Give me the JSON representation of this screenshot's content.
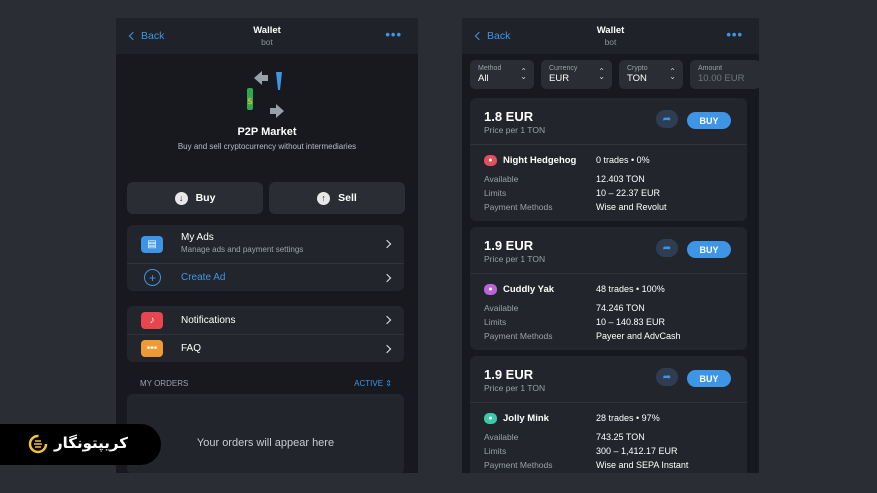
{
  "left": {
    "topbar": {
      "back": "Back",
      "title": "Wallet",
      "subtitle": "bot",
      "more": "•••"
    },
    "hero": {
      "title": "P2P Market",
      "subtitle": "Buy and sell cryptocurrency without intermediaries"
    },
    "actions": {
      "buy": "Buy",
      "sell": "Sell"
    },
    "menu1": [
      {
        "label": "My Ads",
        "sub": "Manage ads and payment settings"
      },
      {
        "label": "Create Ad"
      }
    ],
    "menu2": [
      {
        "label": "Notifications"
      },
      {
        "label": "FAQ"
      }
    ],
    "orders": {
      "heading": "MY ORDERS",
      "filter": "ACTIVE",
      "empty": "Your orders will appear here"
    }
  },
  "right": {
    "topbar": {
      "back": "Back",
      "title": "Wallet",
      "subtitle": "bot",
      "more": "•••"
    },
    "filters": [
      {
        "key": "Method",
        "value": "All"
      },
      {
        "key": "Currency",
        "value": "EUR"
      },
      {
        "key": "Crypto",
        "value": "TON"
      },
      {
        "key": "Amount",
        "value": "10.00 EUR"
      }
    ],
    "buy_label": "BUY",
    "labels": {
      "available": "Available",
      "limits": "Limits",
      "methods": "Payment Methods"
    },
    "offers": [
      {
        "price": "1.8 EUR",
        "per": "Price per 1 TON",
        "seller": "Night Hedgehog",
        "trades": "0 trades • 0%",
        "available": "12.403 TON",
        "limits": "10 – 22.37 EUR",
        "methods": "Wise and Revolut",
        "avatar_color": "#e0505a"
      },
      {
        "price": "1.9 EUR",
        "per": "Price per 1 TON",
        "seller": "Cuddly Yak",
        "trades": "48 trades • 100%",
        "available": "74.246 TON",
        "limits": "10 – 140.83 EUR",
        "methods": "Payeer and AdvCash",
        "avatar_color": "#b866d6"
      },
      {
        "price": "1.9 EUR",
        "per": "Price per 1 TON",
        "seller": "Jolly Mink",
        "trades": "28 trades • 97%",
        "available": "743.25 TON",
        "limits": "300 – 1,412.17 EUR",
        "methods": "Wise and SEPA Instant",
        "avatar_color": "#3cc9a8"
      }
    ]
  },
  "badge": {
    "text": "کریپتونگار"
  },
  "colors": {
    "accent": "#3e95e6",
    "bg": "#17191e",
    "card": "#22252b"
  }
}
